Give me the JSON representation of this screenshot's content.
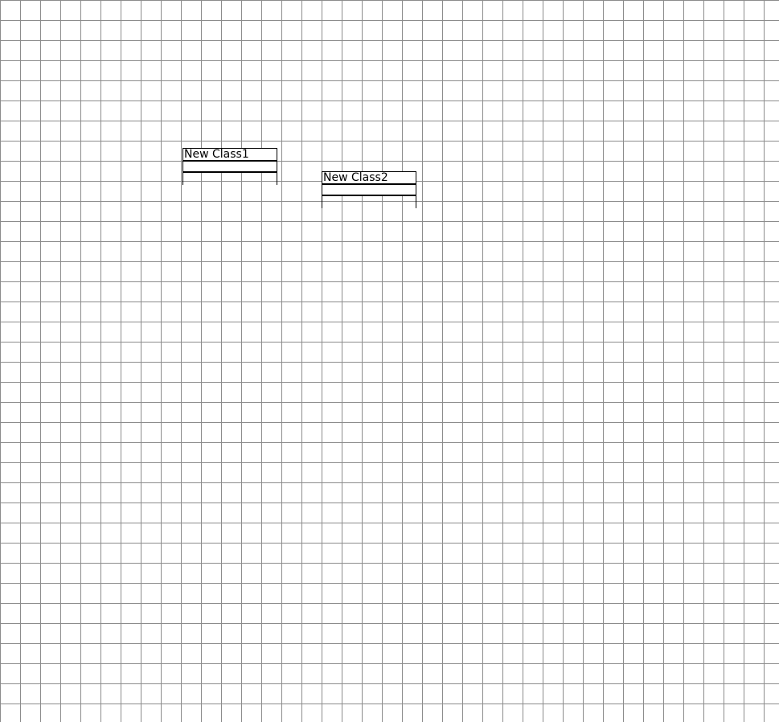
{
  "diagram": {
    "classes": [
      {
        "name": "New Class1"
      },
      {
        "name": "New Class2"
      }
    ]
  }
}
